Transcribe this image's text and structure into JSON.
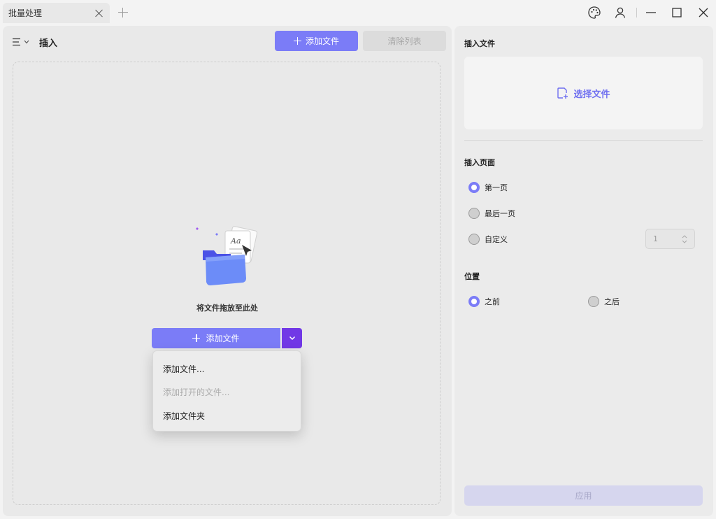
{
  "tab": {
    "title": "批量处理"
  },
  "window_controls": [
    "palette-icon",
    "user-icon",
    "minimize-icon",
    "maximize-icon",
    "close-icon"
  ],
  "left": {
    "title": "插入",
    "add_files_label": "添加文件",
    "clear_list_label": "清除列表",
    "drop_text": "将文件拖放至此处",
    "add_button_label": "添加文件",
    "dropdown": {
      "items": [
        {
          "label": "添加文件...",
          "enabled": true
        },
        {
          "label": "添加打开的文件...",
          "enabled": false
        },
        {
          "label": "添加文件夹",
          "enabled": true
        }
      ]
    }
  },
  "right": {
    "insert_file_heading": "插入文件",
    "choose_file_label": "选择文件",
    "insert_page_heading": "插入页面",
    "page_options": [
      {
        "label": "第一页",
        "selected": true
      },
      {
        "label": "最后一页",
        "selected": false
      },
      {
        "label": "自定义",
        "selected": false
      }
    ],
    "custom_page_value": "1",
    "position_heading": "位置",
    "position_options": [
      {
        "label": "之前",
        "selected": true
      },
      {
        "label": "之后",
        "selected": false
      }
    ],
    "apply_label": "应用"
  },
  "colors": {
    "accent": "#7b7cf7",
    "accent_dark": "#7138e6",
    "disabled_bg": "#d6d6ee"
  }
}
